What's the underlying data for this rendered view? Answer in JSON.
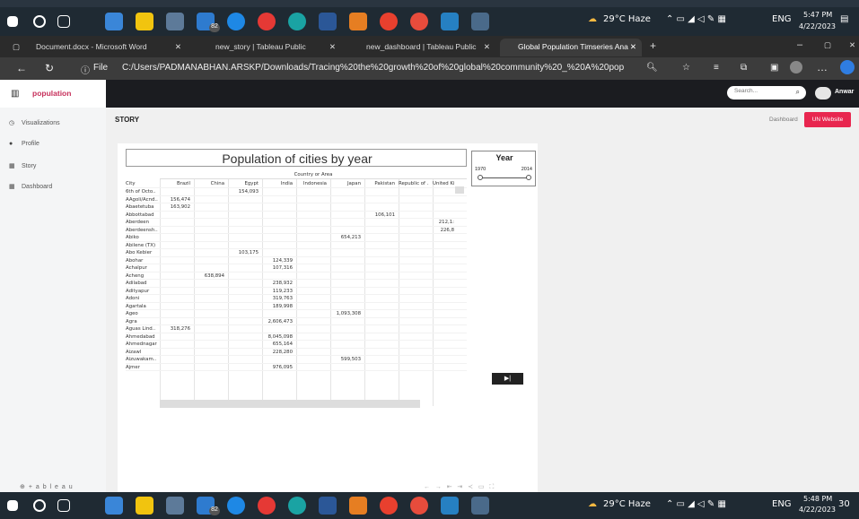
{
  "taskbar": {
    "weather": "29°C Haze",
    "lang": "ENG",
    "time_top": "5:47 PM",
    "date_top": "4/22/2023",
    "time_bottom": "5:48 PM",
    "date_bottom": "4/22/2023",
    "badge": "82",
    "notif": "30"
  },
  "browser": {
    "tabs": [
      "Document.docx - Microsoft Word",
      "new_story | Tableau Public",
      "new_dashboard | Tableau Public",
      "Global Population Timseries Ana"
    ],
    "url_prefix": "File",
    "url": "C:/Users/PADMANABHAN.ARSKP/Downloads/Tracing%20the%20growth%20of%20global%20community%20_%20A%20pop..."
  },
  "app": {
    "brand": "population",
    "nav": [
      "Visualizations",
      "Profile",
      "Story",
      "Dashboard"
    ],
    "search_placeholder": "Search...",
    "user": "Anwar",
    "story_title": "STORY",
    "dashboard_link": "Dashboard",
    "un_button": "UN Website"
  },
  "viz": {
    "title": "Population of cities by year",
    "group_header": "Country or Area",
    "year_filter": {
      "title": "Year",
      "min": "1970",
      "max": "2014"
    },
    "columns": [
      "City",
      "Brazil",
      "China",
      "Egypt",
      "India",
      "Indonesia",
      "Japan",
      "Pakistan",
      "Republic of ..",
      "United Kin"
    ],
    "rows": [
      [
        "6th of Octo..",
        "",
        "",
        "154,093",
        "",
        "",
        "",
        "",
        "",
        ""
      ],
      [
        "AAgoli/Acnd..",
        "156,474",
        "",
        "",
        "",
        "",
        "",
        "",
        "",
        ""
      ],
      [
        "Abaetetuba",
        "163,902",
        "",
        "",
        "",
        "",
        "",
        "",
        "",
        ""
      ],
      [
        "Abbottabad",
        "",
        "",
        "",
        "",
        "",
        "",
        "106,101",
        "",
        ""
      ],
      [
        "Aberdeen",
        "",
        "",
        "",
        "",
        "",
        "",
        "",
        "",
        "212,1:"
      ],
      [
        "Aberdeensh..",
        "",
        "",
        "",
        "",
        "",
        "",
        "",
        "",
        "226,8"
      ],
      [
        "Abiko",
        "",
        "",
        "",
        "",
        "",
        "654,213",
        "",
        "",
        ""
      ],
      [
        "Abilene (TX)",
        "",
        "",
        "",
        "",
        "",
        "",
        "",
        "",
        ""
      ],
      [
        "Abo Kebier",
        "",
        "",
        "103,175",
        "",
        "",
        "",
        "",
        "",
        ""
      ],
      [
        "Abohar",
        "",
        "",
        "",
        "124,339",
        "",
        "",
        "",
        "",
        ""
      ],
      [
        "Achalpur",
        "",
        "",
        "",
        "107,316",
        "",
        "",
        "",
        "",
        ""
      ],
      [
        "Acheng",
        "",
        "638,894",
        "",
        "",
        "",
        "",
        "",
        "",
        ""
      ],
      [
        "Adilabad",
        "",
        "",
        "",
        "238,932",
        "",
        "",
        "",
        "",
        ""
      ],
      [
        "Adityapur",
        "",
        "",
        "",
        "119,233",
        "",
        "",
        "",
        "",
        ""
      ],
      [
        "Adoni",
        "",
        "",
        "",
        "319,763",
        "",
        "",
        "",
        "",
        ""
      ],
      [
        "Agartala",
        "",
        "",
        "",
        "189,998",
        "",
        "",
        "",
        "",
        ""
      ],
      [
        "Ageo",
        "",
        "",
        "",
        "",
        "",
        "1,093,308",
        "",
        "",
        ""
      ],
      [
        "Agra",
        "",
        "",
        "",
        "2,606,473",
        "",
        "",
        "",
        "",
        ""
      ],
      [
        "Aguas Lind..",
        "318,276",
        "",
        "",
        "",
        "",
        "",
        "",
        "",
        ""
      ],
      [
        "Ahmedabad",
        "",
        "",
        "",
        "8,045,098",
        "",
        "",
        "",
        "",
        ""
      ],
      [
        "Ahmednagar",
        "",
        "",
        "",
        "655,164",
        "",
        "",
        "",
        "",
        ""
      ],
      [
        "Aizawl",
        "",
        "",
        "",
        "228,280",
        "",
        "",
        "",
        "",
        ""
      ],
      [
        "Aizuwakam..",
        "",
        "",
        "",
        "",
        "",
        "599,503",
        "",
        "",
        ""
      ],
      [
        "Ajmer",
        "",
        "",
        "",
        "976,095",
        "",
        "",
        "",
        "",
        ""
      ]
    ],
    "play_label": "▶|",
    "footer_brand": "+ a b l e a u"
  }
}
